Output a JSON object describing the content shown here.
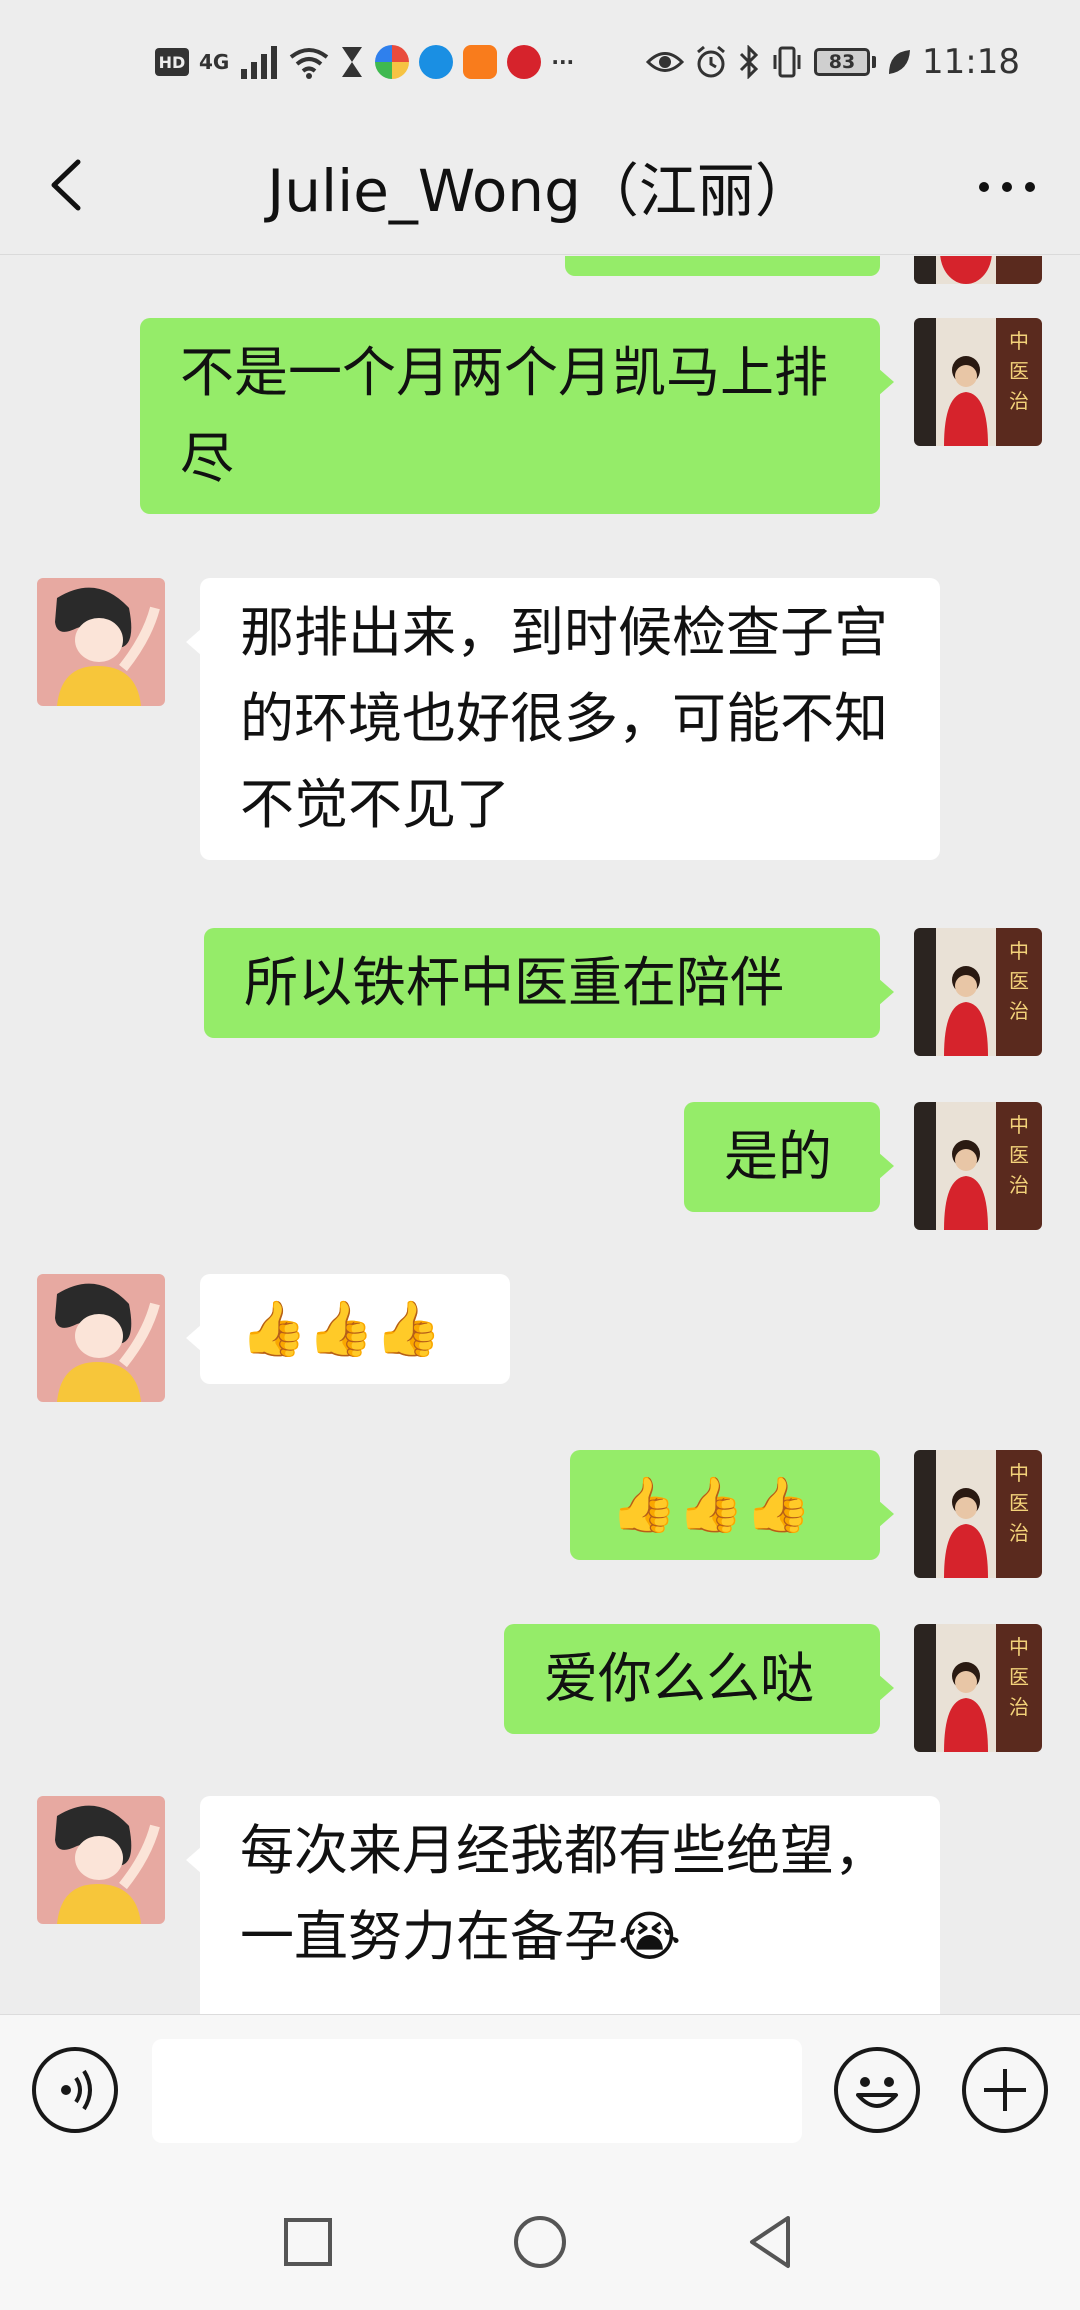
{
  "status_bar": {
    "network_badge": "HD",
    "network_type": "4G",
    "battery": "83",
    "time": "11:18",
    "more_indicator": "···"
  },
  "header": {
    "title": "Julie_Wong（江丽）",
    "back_icon": "chevron-left-icon",
    "more_icon": "more-dots-icon"
  },
  "messages": [
    {
      "sender": "me",
      "text": "不是一个月两个月凯马上排尽"
    },
    {
      "sender": "them",
      "text": "那排出来，到时候检查子宫的环境也好很多，可能不知不觉不见了"
    },
    {
      "sender": "me",
      "text": "所以铁杆中医重在陪伴"
    },
    {
      "sender": "me",
      "text": "是的"
    },
    {
      "sender": "them",
      "text": "👍👍👍"
    },
    {
      "sender": "me",
      "text": "👍👍👍"
    },
    {
      "sender": "me",
      "text": "爱你么么哒"
    },
    {
      "sender": "them",
      "text": "每次来月经我都有些绝望，一直努力在备孕😭"
    }
  ],
  "input_bar": {
    "voice_icon": "voice-icon",
    "emoji_icon": "smiley-icon",
    "plus_icon": "plus-icon",
    "input_value": ""
  },
  "nav_bar": {
    "recents_icon": "square-icon",
    "home_icon": "circle-icon",
    "back_icon": "triangle-back-icon"
  },
  "colors": {
    "background": "#ededed",
    "my_bubble": "#95ec69",
    "their_bubble": "#ffffff"
  }
}
